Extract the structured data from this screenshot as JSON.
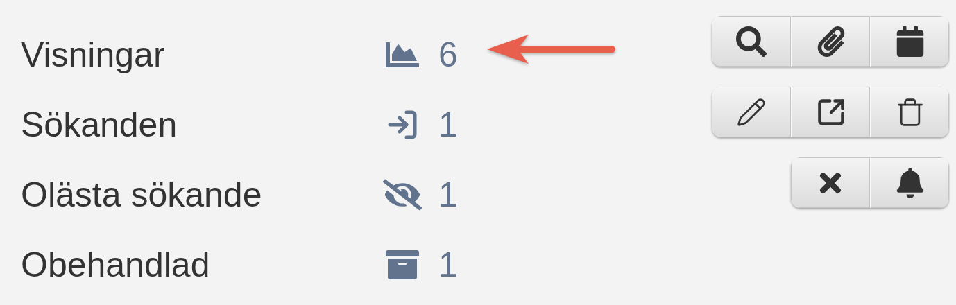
{
  "stats": [
    {
      "kind": "views",
      "label": "Visningar",
      "count": "6"
    },
    {
      "kind": "applicants",
      "label": "Sökanden",
      "count": "1"
    },
    {
      "kind": "unread",
      "label": "Olästa sökande",
      "count": "1"
    },
    {
      "kind": "unhandled",
      "label": "Obehandlad",
      "count": "1"
    }
  ],
  "toolbars": [
    {
      "buttons": [
        {
          "kind": "search"
        },
        {
          "kind": "attach"
        },
        {
          "kind": "calendar"
        }
      ]
    },
    {
      "buttons": [
        {
          "kind": "edit"
        },
        {
          "kind": "external"
        },
        {
          "kind": "delete"
        }
      ]
    },
    {
      "buttons": [
        {
          "kind": "close"
        },
        {
          "kind": "bell"
        }
      ]
    }
  ]
}
